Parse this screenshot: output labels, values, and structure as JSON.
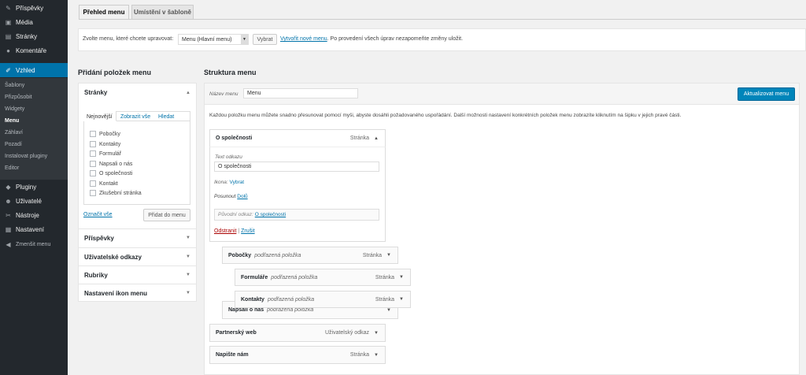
{
  "sidebar": {
    "items": [
      {
        "label": "Příspěvky",
        "icon": "pin-icon"
      },
      {
        "label": "Média",
        "icon": "media-icon"
      },
      {
        "label": "Stránky",
        "icon": "pages-icon"
      },
      {
        "label": "Komentáře",
        "icon": "comment-icon"
      },
      {
        "label": "Vzhled",
        "icon": "brush-icon"
      },
      {
        "label": "Pluginy",
        "icon": "plugin-icon"
      },
      {
        "label": "Uživatelé",
        "icon": "user-icon"
      },
      {
        "label": "Nástroje",
        "icon": "wrench-icon"
      },
      {
        "label": "Nastavení",
        "icon": "settings-icon"
      },
      {
        "label": "Zmenšit menu",
        "icon": "collapse-icon"
      }
    ],
    "submenu": [
      "Šablony",
      "Přizpůsobit",
      "Widgety",
      "Menu",
      "Záhlaví",
      "Pozadí",
      "Instalovat pluginy",
      "Editor"
    ]
  },
  "tabs": [
    "Přehled menu",
    "Umístění v šabloně"
  ],
  "manage": {
    "prompt": "Zvolte menu, které chcete upravovat:",
    "selected": "Menu (Hlavní menu)",
    "select_button": "Vybrat",
    "create_link": "Vytvořit nové menu",
    "note": ". Po provedení všech úprav nezapomeňte změny uložit."
  },
  "add_items": {
    "heading": "Přidání položek menu",
    "pages_title": "Stránky",
    "tabs": [
      "Nejnovější",
      "Zobrazit vše",
      "Hledat"
    ],
    "pages": [
      "Pobočky",
      "Kontakty",
      "Formulář",
      "Napsali o nás",
      "O společnosti",
      "Kontakt",
      "Zkušební stránka"
    ],
    "select_all": "Označit vše",
    "add_button": "Přidat do menu",
    "sections": [
      "Příspěvky",
      "Uživatelské odkazy",
      "Rubriky",
      "Nastavení ikon menu"
    ]
  },
  "structure": {
    "heading": "Struktura menu",
    "name_label": "Název menu",
    "name_value": "Menu",
    "save_button": "Aktualizovat menu",
    "instructions": "Každou položku menu můžete snadno přesunovat pomocí myši, abyste dosáhli požadovaného uspořádání. Další možnosti nastavení konkrétních položek menu zobrazíte kliknutím na šipku v jejich pravé části.",
    "expanded": {
      "title": "O společnosti",
      "type": "Stránka",
      "nav_label": "Text odkazu",
      "nav_value": "O společnosti",
      "icon_label": "Ikona:",
      "icon_link": "Vybrat",
      "move_label": "Posunout",
      "move_link": "Dolů",
      "original_label": "Původní odkaz:",
      "original_link": "O společnosti",
      "remove": "Odstranit",
      "separator": "|",
      "cancel": "Zrušit"
    },
    "sub_label": "podřazená položka",
    "items": [
      {
        "title": "Pobočky",
        "sub": true,
        "type": "Stránka"
      },
      {
        "title": "Formuláře",
        "sub": true,
        "type": "Stránka"
      },
      {
        "title": "Kontakty",
        "sub": true,
        "type": "Stránka"
      },
      {
        "title": "Napsali o nás",
        "sub": true
      },
      {
        "title": "Partnerský web",
        "type": "Uživatelský odkaz"
      },
      {
        "title": "Napište nám",
        "type": "Stránka"
      }
    ]
  },
  "colors": {
    "sidebar": "#23282d",
    "accent": "#0073aa",
    "primary_button": "#0085ba"
  }
}
